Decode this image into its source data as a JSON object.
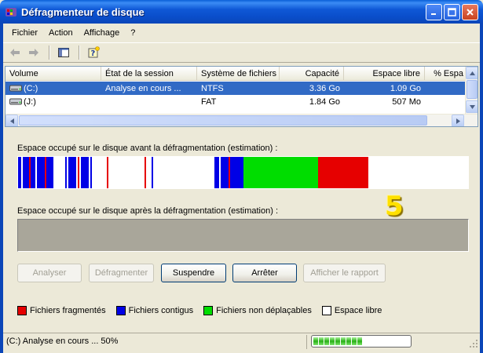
{
  "window": {
    "title": "Défragmenteur de disque"
  },
  "menu": [
    "Fichier",
    "Action",
    "Affichage",
    "?"
  ],
  "volume_list": {
    "columns": [
      "Volume",
      "État de la session",
      "Système de fichiers",
      "Capacité",
      "Espace libre",
      "% Espa"
    ],
    "rows": [
      {
        "volume": "(C:)",
        "session": "Analyse en cours ...",
        "fs": "NTFS",
        "capacity": "3.36 Go",
        "free": "1.09 Go",
        "selected": true
      },
      {
        "volume": "(J:)",
        "session": "",
        "fs": "FAT",
        "capacity": "1.84 Go",
        "free": "507 Mo",
        "selected": false
      }
    ]
  },
  "analysis": {
    "before_label": "Espace occupé sur le disque avant la défragmentation (estimation) :",
    "after_label": "Espace occupé sur le disque après la défragmentation (estimation) :",
    "step_number": "5"
  },
  "buttons": {
    "analyze": "Analyser",
    "defragment": "Défragmenter",
    "pause": "Suspendre",
    "stop": "Arrêter",
    "report": "Afficher le rapport"
  },
  "legend": [
    {
      "label": "Fichiers fragmentés",
      "color": "#e60000"
    },
    {
      "label": "Fichiers contigus",
      "color": "#0000e6"
    },
    {
      "label": "Fichiers non déplaçables",
      "color": "#00dd00"
    },
    {
      "label": "Espace libre",
      "color": "#ffffff"
    }
  ],
  "status": {
    "text": "(C:) Analyse en cours ... 50%",
    "progress_percent": 50
  },
  "colors": {
    "fragmented": "#e60000",
    "contiguous": "#0000e6",
    "unmovable": "#00dd00",
    "free": "#ffffff",
    "selection": "#316ac5"
  }
}
